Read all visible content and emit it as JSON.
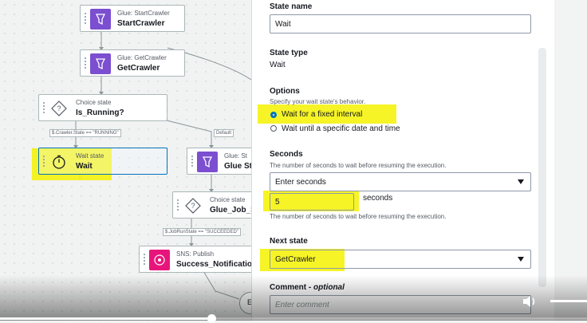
{
  "canvas": {
    "nodes": [
      {
        "id": "startcrawler",
        "kind": "Glue: StartCrawler",
        "title": "StartCrawler",
        "icon": "glue-crawler-icon"
      },
      {
        "id": "getcrawler",
        "kind": "Glue: GetCrawler",
        "title": "GetCrawler",
        "icon": "glue-crawler-icon"
      },
      {
        "id": "is_running",
        "kind": "Choice state",
        "title": "Is_Running?",
        "icon": "choice-state-icon"
      },
      {
        "id": "wait",
        "kind": "Wait state",
        "title": "Wait",
        "icon": "stopwatch-icon"
      },
      {
        "id": "glue_start_job",
        "kind": "Glue: St",
        "title": "Glue St",
        "icon": "glue-crawler-icon"
      },
      {
        "id": "glue_job_status",
        "kind": "Choice state",
        "title": "Glue_Job_S",
        "icon": "choice-state-icon"
      },
      {
        "id": "success_notification",
        "kind": "SNS: Publish",
        "title": "Success_Notification",
        "icon": "sns-icon"
      }
    ],
    "edge_labels": {
      "crawler_running": "$.Crawler.State == \"RUNNING\"",
      "default": "Default",
      "job_succeeded": "$.JobRunState == \"SUCCEEDED\""
    },
    "end_marker": "E"
  },
  "panel": {
    "state_name_label": "State name",
    "state_name_value": "Wait",
    "state_type_label": "State type",
    "state_type_value": "Wait",
    "options_label": "Options",
    "options_desc": "Specify your wait state's behavior.",
    "option_fixed": "Wait for a fixed interval",
    "option_until": "Wait until a specific date and time",
    "selected_option": "Wait for a fixed interval",
    "seconds_label": "Seconds",
    "seconds_desc": "The number of seconds to wait before resuming the execution.",
    "seconds_mode": "Enter seconds",
    "seconds_value": "5",
    "seconds_unit": "seconds",
    "seconds_help": "The number of seconds to wait before resuming the execution.",
    "next_state_label": "Next state",
    "next_state_value": "GetCrawler",
    "comment_label": "Comment",
    "comment_optional": "optional",
    "comment_placeholder": "Enter comment"
  },
  "colors": {
    "glue": "#7b4fd0",
    "sns": "#e7157b",
    "highlight": "#f4f200",
    "radio_selected": "#0073bb"
  },
  "video": {
    "progress": 0.36
  }
}
